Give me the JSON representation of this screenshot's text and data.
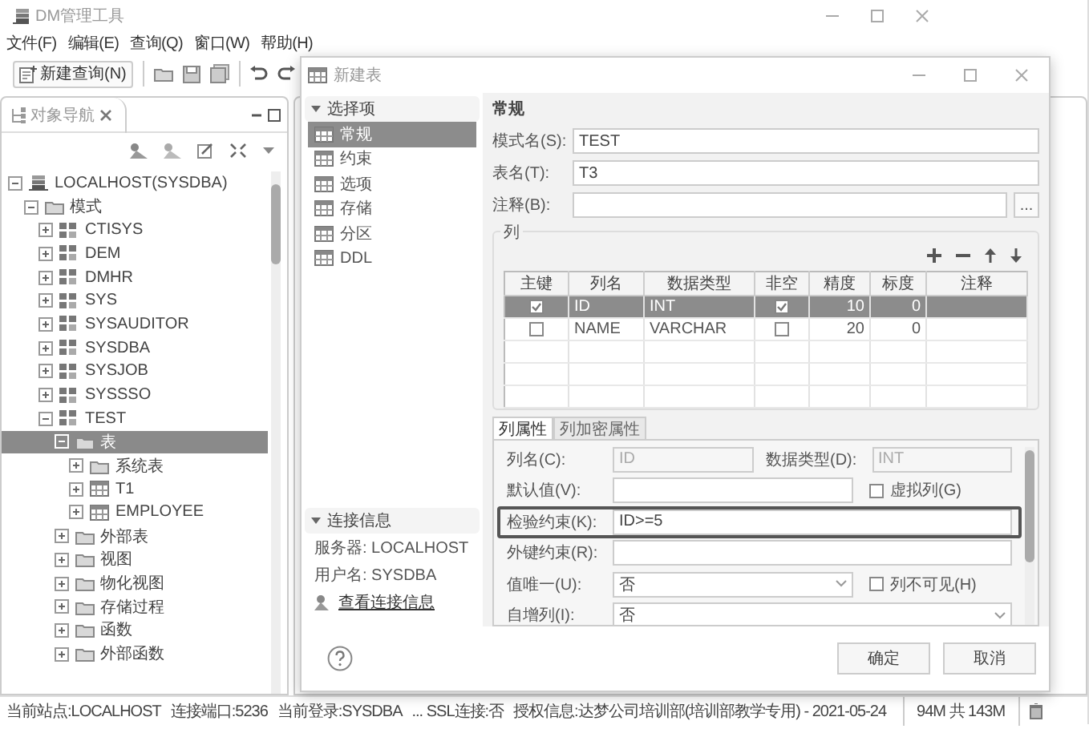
{
  "main_window": {
    "title": "DM管理工具",
    "menu": [
      "文件(F)",
      "编辑(E)",
      "查询(Q)",
      "窗口(W)",
      "帮助(H)"
    ],
    "toolbar": {
      "new_query": "新建查询(N)"
    },
    "navigator": {
      "tab": "对象导航",
      "tree": [
        {
          "label": "LOCALHOST(SYSDBA)",
          "kind": "server",
          "expanded": true,
          "selected": false,
          "children": [
            {
              "label": "模式",
              "kind": "folder",
              "expanded": true,
              "selected": false,
              "children": [
                {
                  "label": "CTISYS",
                  "kind": "schema",
                  "expanded": false,
                  "selected": false
                },
                {
                  "label": "DEM",
                  "kind": "schema",
                  "expanded": false,
                  "selected": false
                },
                {
                  "label": "DMHR",
                  "kind": "schema",
                  "expanded": false,
                  "selected": false
                },
                {
                  "label": "SYS",
                  "kind": "schema",
                  "expanded": false,
                  "selected": false
                },
                {
                  "label": "SYSAUDITOR",
                  "kind": "schema",
                  "expanded": false,
                  "selected": false
                },
                {
                  "label": "SYSDBA",
                  "kind": "schema",
                  "expanded": false,
                  "selected": false
                },
                {
                  "label": "SYSJOB",
                  "kind": "schema",
                  "expanded": false,
                  "selected": false
                },
                {
                  "label": "SYSSSO",
                  "kind": "schema",
                  "expanded": false,
                  "selected": false
                },
                {
                  "label": "TEST",
                  "kind": "schema",
                  "expanded": true,
                  "selected": false,
                  "children": [
                    {
                      "label": "表",
                      "kind": "folder",
                      "expanded": true,
                      "selected": true,
                      "children": [
                        {
                          "label": "系统表",
                          "kind": "folder",
                          "expanded": false,
                          "selected": false
                        },
                        {
                          "label": "T1",
                          "kind": "table",
                          "expanded": false,
                          "selected": false
                        },
                        {
                          "label": "EMPLOYEE",
                          "kind": "table",
                          "expanded": false,
                          "selected": false
                        }
                      ]
                    },
                    {
                      "label": "外部表",
                      "kind": "folder",
                      "expanded": false,
                      "selected": false
                    },
                    {
                      "label": "视图",
                      "kind": "folder",
                      "expanded": false,
                      "selected": false
                    },
                    {
                      "label": "物化视图",
                      "kind": "folder",
                      "expanded": false,
                      "selected": false
                    },
                    {
                      "label": "存储过程",
                      "kind": "folder",
                      "expanded": false,
                      "selected": false
                    },
                    {
                      "label": "函数",
                      "kind": "folder",
                      "expanded": false,
                      "selected": false
                    },
                    {
                      "label": "外部函数",
                      "kind": "folder",
                      "expanded": false,
                      "selected": false
                    }
                  ]
                }
              ]
            }
          ]
        }
      ]
    },
    "status_bar": [
      "当前站点:LOCALHOST",
      "连接端口:5236",
      "当前登录:SYSDBA",
      "... SSL连接:否",
      "授权信息:达梦公司培训部(培训部教学专用) - 2021-05-24"
    ],
    "memory": "94M 共 143M"
  },
  "dialog": {
    "title": "新建表",
    "options": {
      "header": "选择项",
      "items": [
        {
          "label": "常规",
          "selected": true
        },
        {
          "label": "约束",
          "selected": false
        },
        {
          "label": "选项",
          "selected": false
        },
        {
          "label": "存储",
          "selected": false
        },
        {
          "label": "分区",
          "selected": false
        },
        {
          "label": "DDL",
          "selected": false
        }
      ]
    },
    "connection": {
      "header": "连接信息",
      "server": "服务器: LOCALHOST",
      "user": "用户名: SYSDBA",
      "link": "查看连接信息"
    },
    "section_title": "常规",
    "fields": [
      {
        "label": "模式名(S):",
        "value": "TEST"
      },
      {
        "label": "表名(T):",
        "value": "T3"
      },
      {
        "label": "注释(B):",
        "button": "..."
      }
    ],
    "columns_group": {
      "title": "列",
      "columns": [
        "主键",
        "列名",
        "数据类型",
        "非空",
        "精度",
        "标度",
        "注释"
      ],
      "rows": [
        {
          "selected": true,
          "primary_key": true,
          "name": "ID",
          "type": "INT",
          "not_null": true,
          "precision": "10",
          "scale": "0"
        },
        {
          "selected": false,
          "primary_key": false,
          "name": "NAME",
          "type": "VARCHAR",
          "not_null": false,
          "precision": "20",
          "scale": "0"
        }
      ]
    },
    "property_tabs": [
      {
        "label": "列属性",
        "selected": true
      },
      {
        "label": "列加密属性",
        "selected": false
      }
    ],
    "properties": [
      {
        "kind": "pair",
        "label": "列名(C):",
        "value": "ID",
        "label2": "数据类型(D):",
        "value2": "INT",
        "disabled": true
      },
      {
        "kind": "check",
        "label": "默认值(V):",
        "check_label": "虚拟列(G)",
        "checked": false
      },
      {
        "kind": "text",
        "label": "检验约束(K):",
        "value": "ID>=5",
        "focused": true
      },
      {
        "kind": "text",
        "label": "外键约束(R):",
        "focused": false
      },
      {
        "kind": "select_check",
        "label": "值唯一(U):",
        "value": "否",
        "check_label": "列不可见(H)",
        "checked": false
      },
      {
        "kind": "select",
        "label": "自增列(I):",
        "value": "否"
      }
    ],
    "buttons": [
      "确定",
      "取消"
    ]
  }
}
